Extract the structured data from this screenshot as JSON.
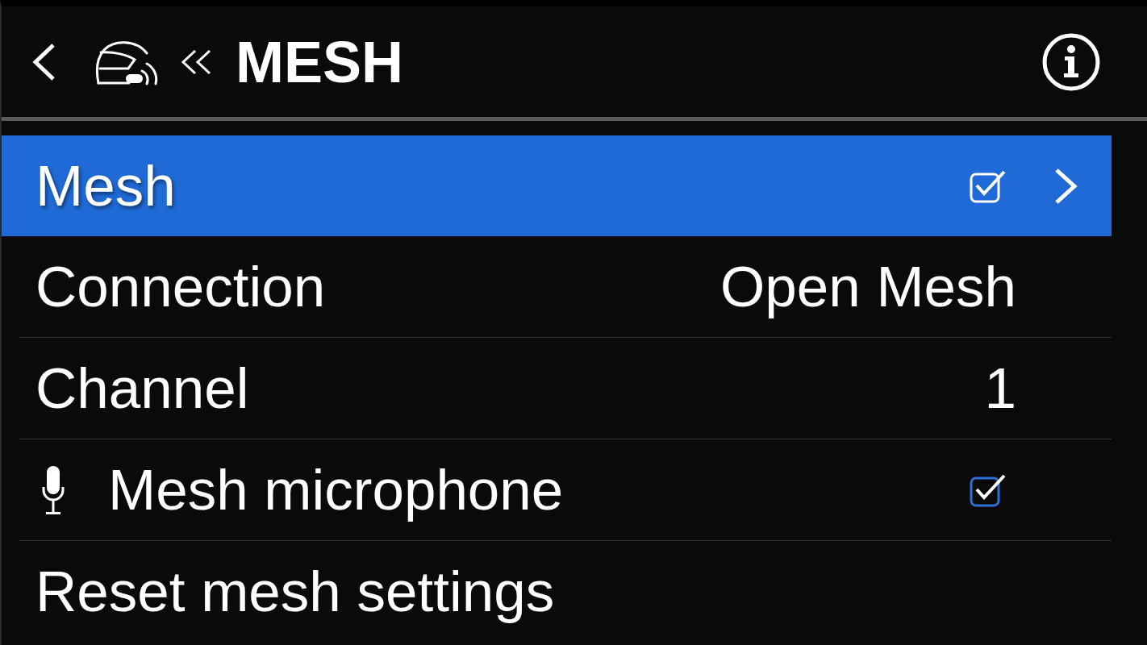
{
  "header": {
    "title": "MESH"
  },
  "items": [
    {
      "kind": "submenu",
      "label": "Mesh",
      "selected": true,
      "checked": true
    },
    {
      "kind": "value",
      "label": "Connection",
      "value": "Open Mesh",
      "selected": false
    },
    {
      "kind": "value",
      "label": "Channel",
      "value": "1",
      "selected": false
    },
    {
      "kind": "toggle",
      "label": "Mesh microphone",
      "selected": false,
      "checked": true
    },
    {
      "kind": "action",
      "label": "Reset mesh settings",
      "selected": false
    }
  ]
}
